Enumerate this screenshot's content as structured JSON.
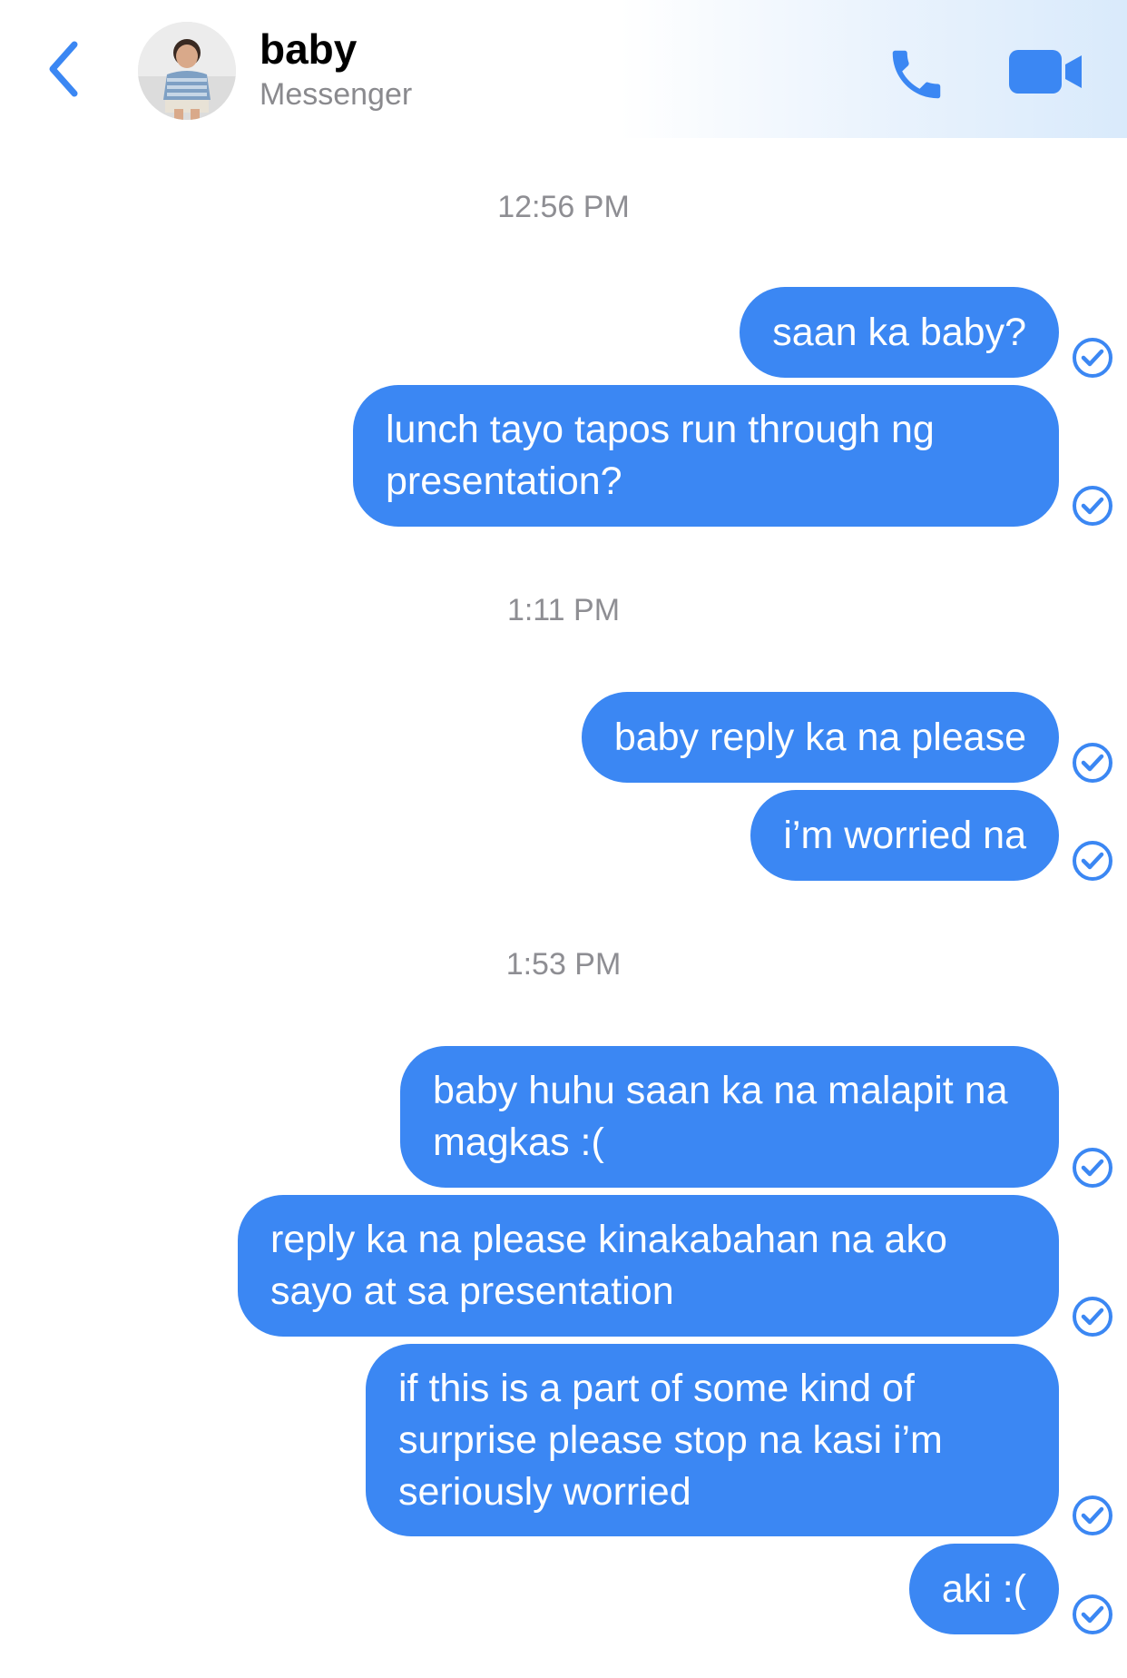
{
  "header": {
    "contact_name": "baby",
    "contact_subtitle": "Messenger",
    "accent_color": "#3b87f3"
  },
  "icons": {
    "back": "chevron-left-icon",
    "call": "phone-icon",
    "video": "video-camera-icon",
    "status": "sent-check-icon"
  },
  "conversation": {
    "groups": [
      {
        "time": "12:56 PM",
        "messages": [
          {
            "text": "saan ka baby?",
            "status": "sent"
          },
          {
            "text": "lunch tayo tapos run through ng presentation?",
            "status": "sent"
          }
        ]
      },
      {
        "time": "1:11 PM",
        "messages": [
          {
            "text": "baby reply ka na please",
            "status": "sent"
          },
          {
            "text": "i’m worried na",
            "status": "sent"
          }
        ]
      },
      {
        "time": "1:53 PM",
        "messages": [
          {
            "text": "baby huhu saan ka na malapit na magkas :(",
            "status": "sent"
          },
          {
            "text": "reply ka na please kinakabahan na ako sayo at sa presentation",
            "status": "sent"
          },
          {
            "text": "if this is a part of some kind of surprise please stop na kasi i’m seriously worried",
            "status": "sent"
          },
          {
            "text": "aki :(",
            "status": "sent"
          }
        ]
      }
    ]
  }
}
